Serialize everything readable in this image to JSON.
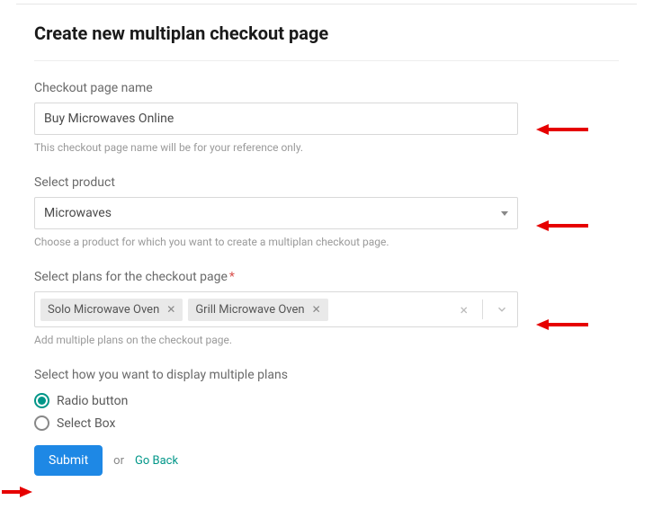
{
  "title": "Create new multiplan checkout page",
  "checkout_name": {
    "label": "Checkout page name",
    "value": "Buy Microwaves Online",
    "help": "This checkout page name will be for your reference only."
  },
  "product": {
    "label": "Select product",
    "value": "Microwaves",
    "help": "Choose a product for which you want to create a multiplan checkout page."
  },
  "plans": {
    "label": "Select plans for the checkout page",
    "required_marker": "*",
    "chips": [
      "Solo Microwave Oven",
      "Grill Microwave Oven"
    ],
    "help": "Add multiple plans on the checkout page."
  },
  "display": {
    "label": "Select how you want to display multiple plans",
    "options": {
      "radio": "Radio button",
      "selectbox": "Select Box"
    },
    "selected": "radio"
  },
  "actions": {
    "submit": "Submit",
    "or": "or",
    "goback": "Go Back"
  }
}
